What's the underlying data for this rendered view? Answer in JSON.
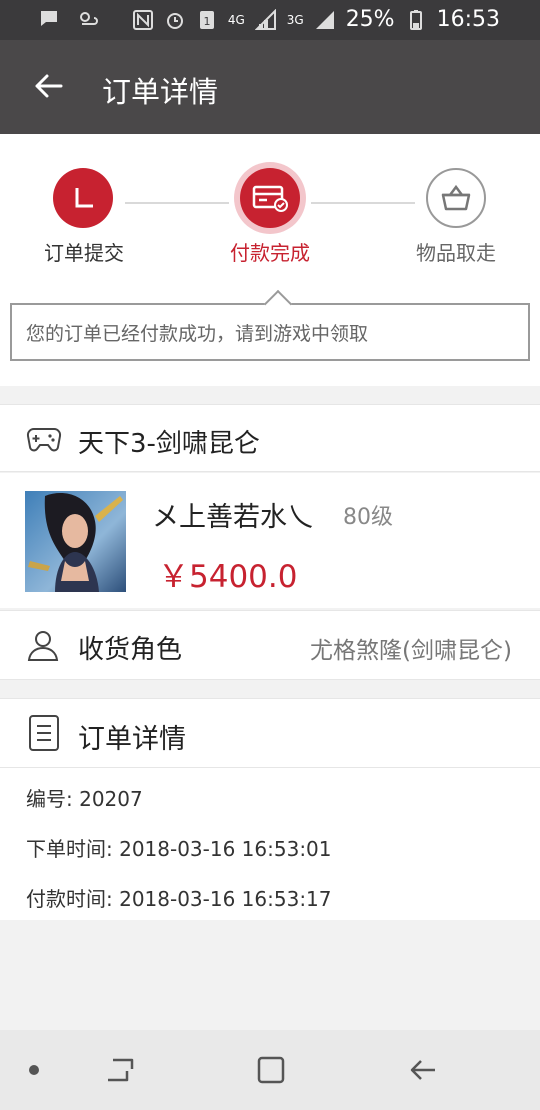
{
  "status_bar": {
    "battery": "25%",
    "time": "16:53",
    "network_1": "4G",
    "network_2": "3G",
    "icons": [
      "message-icon",
      "weather-icon",
      "nfc-icon",
      "alarm-icon",
      "sim-icon",
      "signal-icon",
      "battery-icon"
    ]
  },
  "header": {
    "title": "订单详情",
    "back_icon": "arrow-left-icon"
  },
  "steps": [
    {
      "label": "订单提交",
      "icon": "clock-icon",
      "state": "done"
    },
    {
      "label": "付款完成",
      "icon": "card-check-icon",
      "state": "current"
    },
    {
      "label": "物品取走",
      "icon": "basket-icon",
      "state": "pending"
    }
  ],
  "notice": "您的订单已经付款成功，请到游戏中领取",
  "game": {
    "title": "天下3-剑啸昆仑",
    "icon": "gamepad-icon"
  },
  "product": {
    "name": "メ上善若水乀",
    "level": "80级",
    "price": "￥5400.0"
  },
  "receiver": {
    "label": "收货角色",
    "value": "尤格煞隆(剑啸昆仑)",
    "icon": "user-icon"
  },
  "order_details": {
    "title": "订单详情",
    "icon": "document-icon",
    "lines": [
      "编号: 20207",
      "下单时间: 2018-03-16 16:53:01",
      "付款时间: 2018-03-16 16:53:17"
    ]
  },
  "nav": {
    "buttons": [
      "dot-icon",
      "recent-apps-icon",
      "home-icon",
      "back-icon"
    ]
  },
  "colors": {
    "accent": "#c72230",
    "app_bar": "#4a4849",
    "status_bar": "#3b3a3c"
  }
}
